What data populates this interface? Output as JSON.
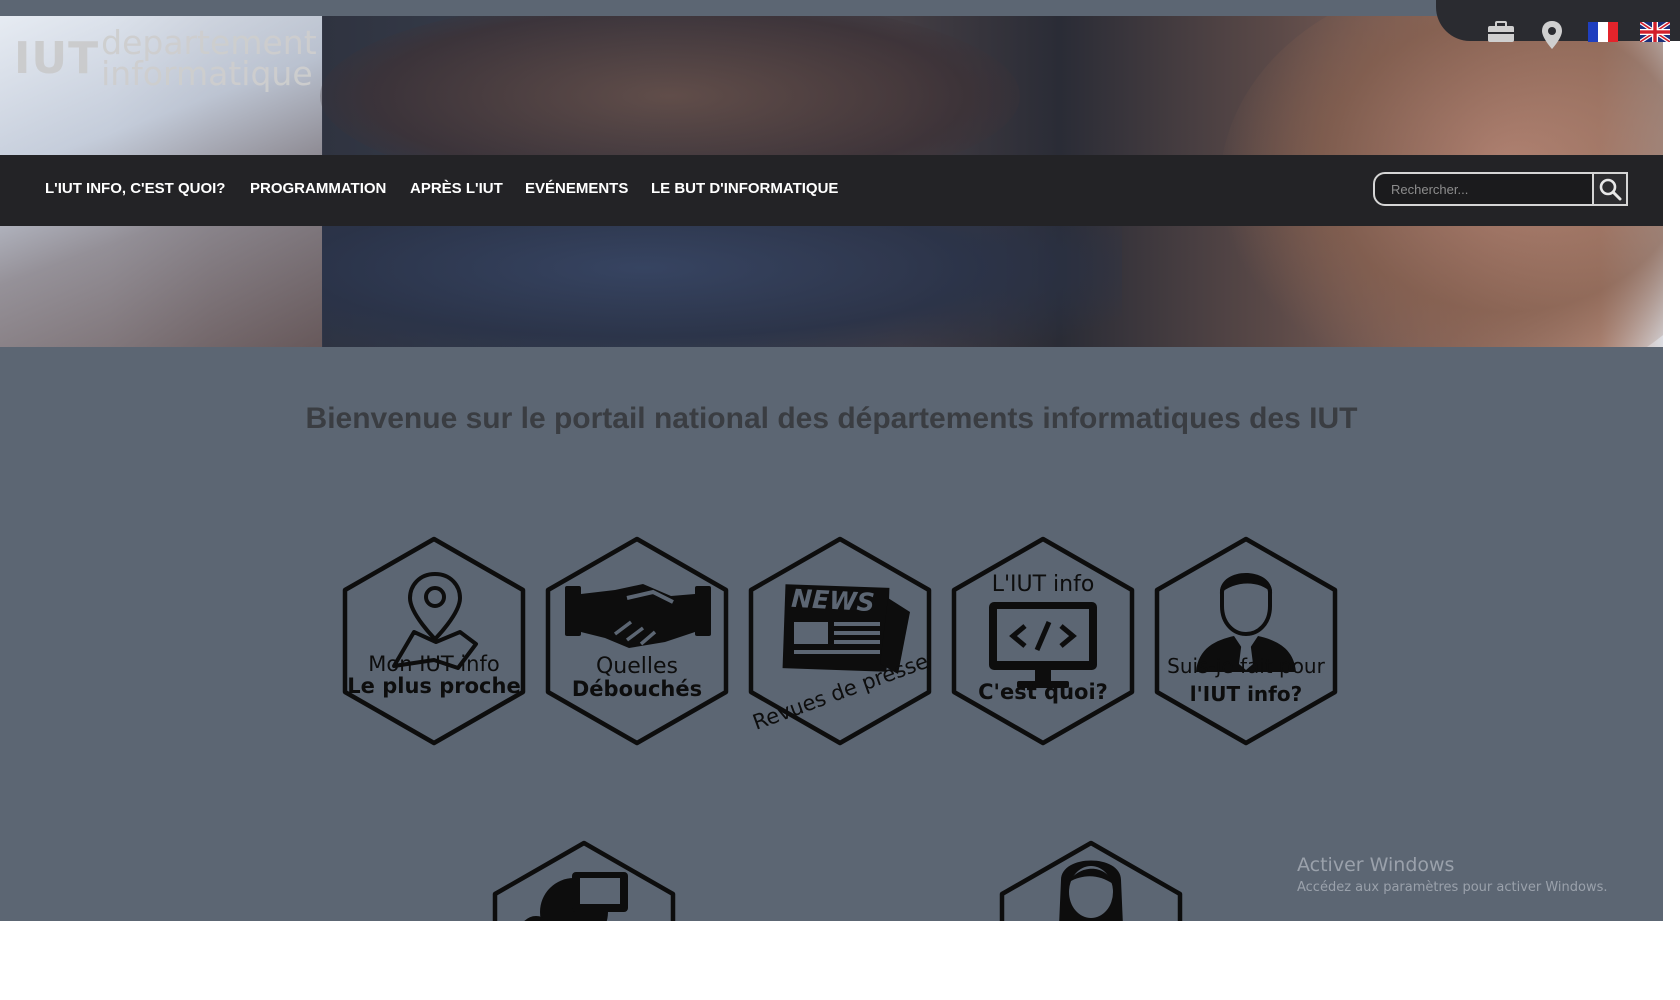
{
  "logo": {
    "iut": "IUT",
    "line1": "departement",
    "line2": "informatique"
  },
  "header_icons": [
    {
      "name": "briefcase-icon"
    },
    {
      "name": "location-pin-icon"
    },
    {
      "name": "french-flag-icon"
    },
    {
      "name": "uk-flag-icon"
    }
  ],
  "nav": {
    "items": [
      "L'IUT INFO, C'EST QUOI?",
      "PROGRAMMATION",
      "APRÈS L'IUT",
      "EVÉNEMENTS",
      "LE BUT D'INFORMATIQUE"
    ]
  },
  "search": {
    "placeholder": "Rechercher..."
  },
  "welcome": "Bienvenue sur le portail national des départements informatiques des IUT",
  "tiles": [
    {
      "line1": "Mon IUT info",
      "line2": "Le plus proche",
      "icon": "map-pin-icon"
    },
    {
      "line1": "Quelles",
      "line2": "Débouchés",
      "icon": "handshake-icon"
    },
    {
      "line1": "NEWS",
      "line2": "Revues de presse",
      "icon": "newspaper-icon"
    },
    {
      "line1": "L'IUT info",
      "line2": "C'est quoi?",
      "icon": "code-monitor-icon"
    },
    {
      "line1": "Suis-je fait pour",
      "line2": "l'IUT info?",
      "icon": "businessman-icon"
    }
  ],
  "tiles_row2": [
    {
      "icon": "computer-network-icon"
    },
    {
      "icon": "woman-icon"
    }
  ],
  "watermark": {
    "title": "Activer Windows",
    "subtitle": "Accédez aux paramètres pour activer Windows."
  },
  "colors": {
    "page_bg": "#5c6673",
    "nav_bg": "#232326",
    "tile_stroke": "#0d0d0d",
    "welcome_text": "#3a3d42"
  }
}
